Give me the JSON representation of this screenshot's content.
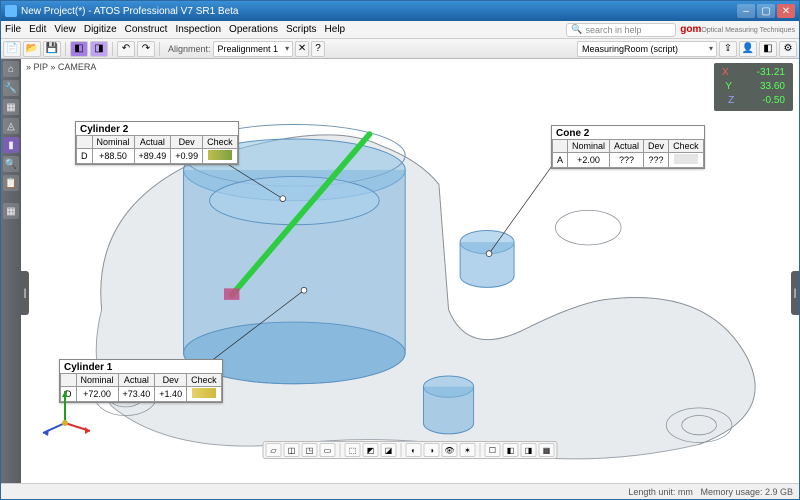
{
  "title": "New Project(*) - ATOS Professional V7 SR1 Beta",
  "menus": [
    "File",
    "Edit",
    "View",
    "Digitize",
    "Construct",
    "Inspection",
    "Operations",
    "Scripts",
    "Help"
  ],
  "search_placeholder": "search in help",
  "logo": "gom",
  "logo_sub": "Optical Measuring Techniques",
  "alignment_label": "Alignment:",
  "alignment_value": "Prealignment 1",
  "script_label": "MeasuringRoom (script)",
  "pip": "» PIP  » CAMERA",
  "coords": {
    "x": "-31.21",
    "y": "33.60",
    "z": "-0.50"
  },
  "callouts": {
    "cyl2": {
      "title": "Cylinder 2",
      "row": "D",
      "nominal": "+88.50",
      "actual": "+89.49",
      "dev": "+0.99",
      "check": "g"
    },
    "cyl1": {
      "title": "Cylinder 1",
      "row": "D",
      "nominal": "+72.00",
      "actual": "+73.40",
      "dev": "+1.40",
      "check": "y"
    },
    "cone2": {
      "title": "Cone 2",
      "row": "A",
      "nominal": "+2.00",
      "actual": "???",
      "dev": "???",
      "check": "n"
    }
  },
  "headers": [
    "",
    "Nominal",
    "Actual",
    "Dev",
    "Check"
  ],
  "status_left": "",
  "status_unit": "Length unit: mm",
  "status_mem": "Memory usage: 2.9 GB"
}
